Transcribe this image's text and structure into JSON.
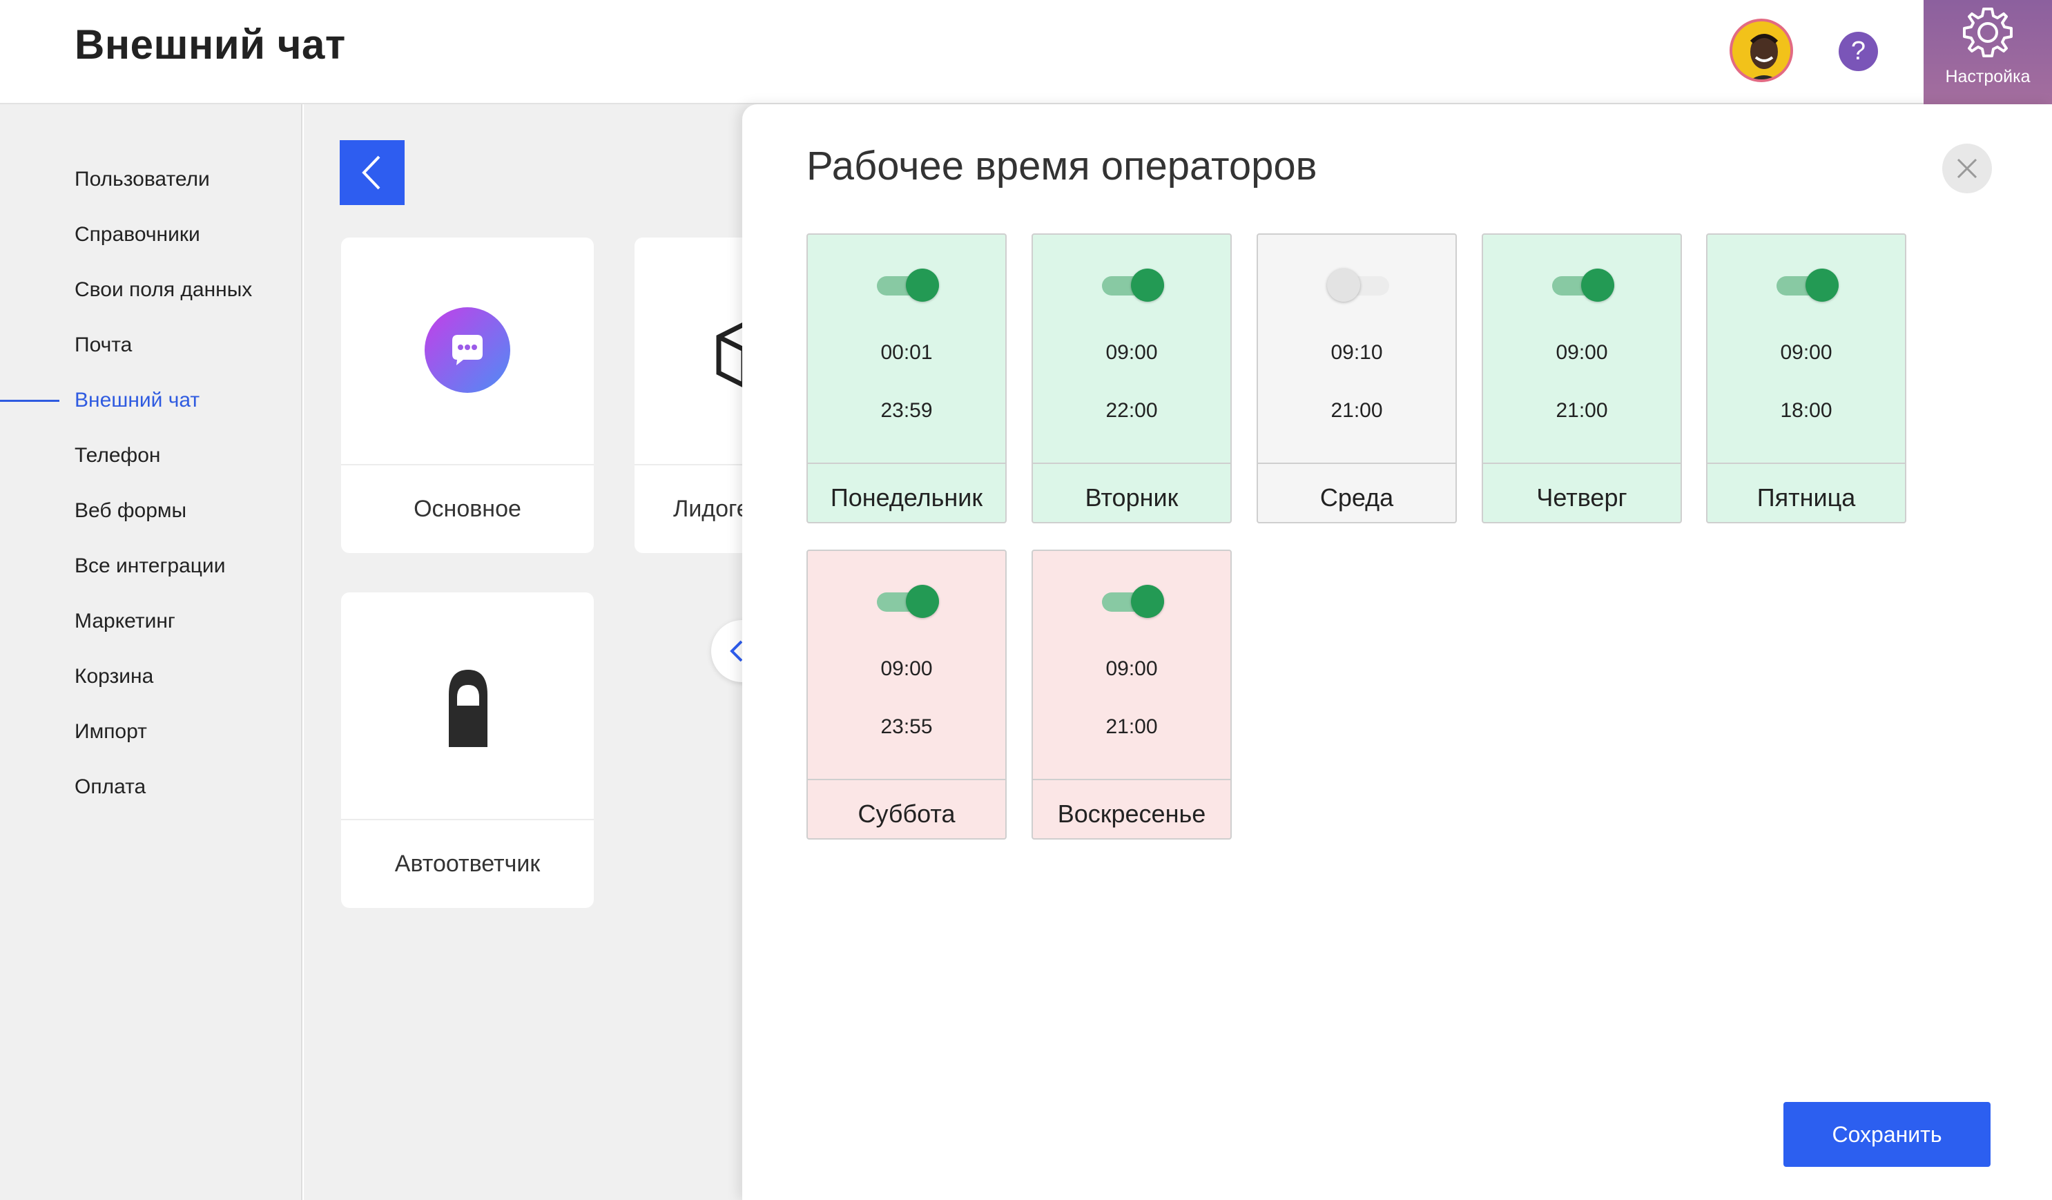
{
  "header": {
    "title": "Внешний чат",
    "avatar_icon": "user-avatar",
    "help_label": "?",
    "settings_label": "Настройка",
    "settings_icon": "gear-icon"
  },
  "sidebar": {
    "items": [
      {
        "label": "Пользователи"
      },
      {
        "label": "Справочники"
      },
      {
        "label": "Свои поля данных"
      },
      {
        "label": "Почта"
      },
      {
        "label": "Внешний чат",
        "active": true
      },
      {
        "label": "Телефон"
      },
      {
        "label": "Веб формы"
      },
      {
        "label": "Все интеграции"
      },
      {
        "label": "Маркетинг"
      },
      {
        "label": "Корзина"
      },
      {
        "label": "Импорт"
      },
      {
        "label": "Оплата"
      }
    ]
  },
  "content": {
    "back_icon": "chevron-left-icon",
    "tiles": [
      {
        "label": "Основное",
        "icon": "chat-bubble-icon"
      },
      {
        "label": "Лидоге",
        "icon": "box-icon"
      },
      {
        "label": "Автоответчик",
        "icon": "door-hanger-icon"
      }
    ]
  },
  "panel": {
    "title": "Рабочее время операторов",
    "close_icon": "close-icon",
    "save_label": "Сохранить",
    "days": [
      {
        "name": "Понедельник",
        "enabled": true,
        "start": "00:01",
        "end": "23:59",
        "tone": "green"
      },
      {
        "name": "Вторник",
        "enabled": true,
        "start": "09:00",
        "end": "22:00",
        "tone": "green"
      },
      {
        "name": "Среда",
        "enabled": false,
        "start": "09:10",
        "end": "21:00",
        "tone": "off"
      },
      {
        "name": "Четверг",
        "enabled": true,
        "start": "09:00",
        "end": "21:00",
        "tone": "green"
      },
      {
        "name": "Пятница",
        "enabled": true,
        "start": "09:00",
        "end": "18:00",
        "tone": "green"
      },
      {
        "name": "Суббота",
        "enabled": true,
        "start": "09:00",
        "end": "23:55",
        "tone": "red"
      },
      {
        "name": "Воскресенье",
        "enabled": true,
        "start": "09:00",
        "end": "21:00",
        "tone": "red"
      }
    ]
  },
  "colors": {
    "accent": "#2e5df0",
    "settings_bg": "#8c609e",
    "help_bg": "#7a55b8",
    "workday_bg": "#dcf6e8",
    "weekend_bg": "#fbe6e6",
    "disabled_bg": "#f5f5f5",
    "toggle_on": "#239a54"
  }
}
